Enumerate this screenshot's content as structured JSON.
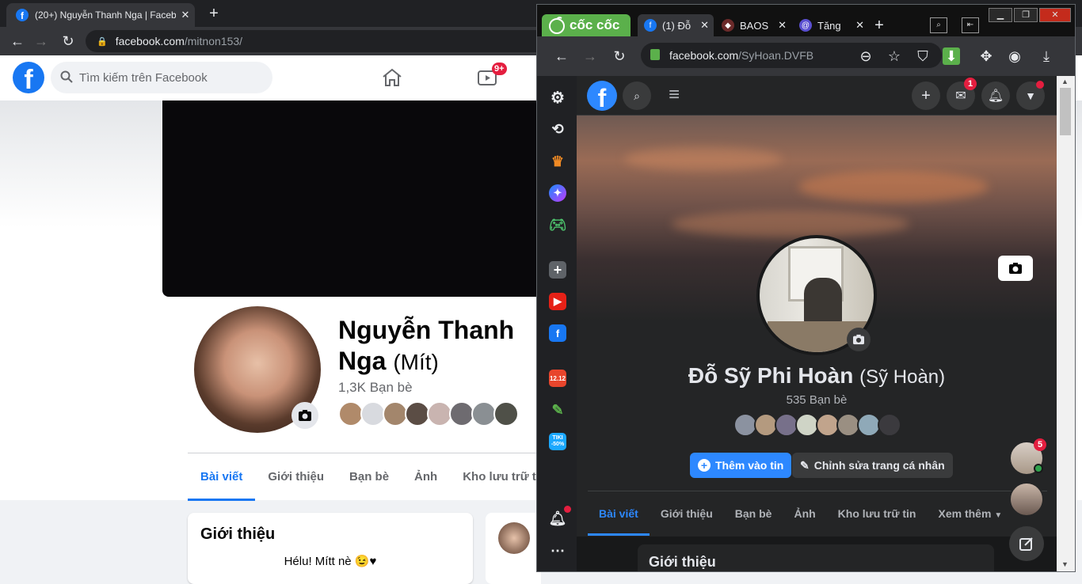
{
  "left_browser": {
    "tab_title": "(20+) Nguyễn Thanh Nga | Faceb",
    "tab_favicon": "f",
    "url_host": "facebook.com",
    "url_path": "/mitnon153/",
    "search_placeholder": "Tìm kiếm trên Facebook",
    "watch_badge": "9+",
    "profile": {
      "name": "Nguyễn Thanh Nga",
      "alt_name": "(Mít)",
      "friends": "1,3K Bạn bè",
      "tabs": [
        "Bài viết",
        "Giới thiệu",
        "Bạn bè",
        "Ảnh",
        "Kho lưu trữ tin"
      ],
      "intro_title": "Giới thiệu",
      "bio": "Hélu! Mítt nè 😉♥"
    }
  },
  "right_browser": {
    "brand": "cốc cốc",
    "tabs": [
      {
        "title": "(1) Đỗ",
        "icon": "facebook-icon"
      },
      {
        "title": "BAOS",
        "icon": "game-icon"
      },
      {
        "title": "Tăng",
        "icon": "swirl-icon"
      }
    ],
    "url_host": "facebook.com",
    "url_path": "/SyHoan.DVFB",
    "messenger_badge": "1",
    "sidebar_badges": {
      "shop_label": "12.12",
      "tiki_label": "TIKI",
      "tiki_discount": "-50%"
    },
    "profile": {
      "name": "Đỗ Sỹ Phi Hoàn",
      "alt_name": "(Sỹ Hoàn)",
      "friends": "535 Bạn bè",
      "add_story": "Thêm vào tin",
      "edit_profile": "Chỉnh sửa trang cá nhân",
      "tabs": [
        "Bài viết",
        "Giới thiệu",
        "Bạn bè",
        "Ảnh",
        "Kho lưu trữ tin",
        "Xem thêm"
      ],
      "intro_title": "Giới thiệu"
    },
    "chat_badge": "5"
  }
}
